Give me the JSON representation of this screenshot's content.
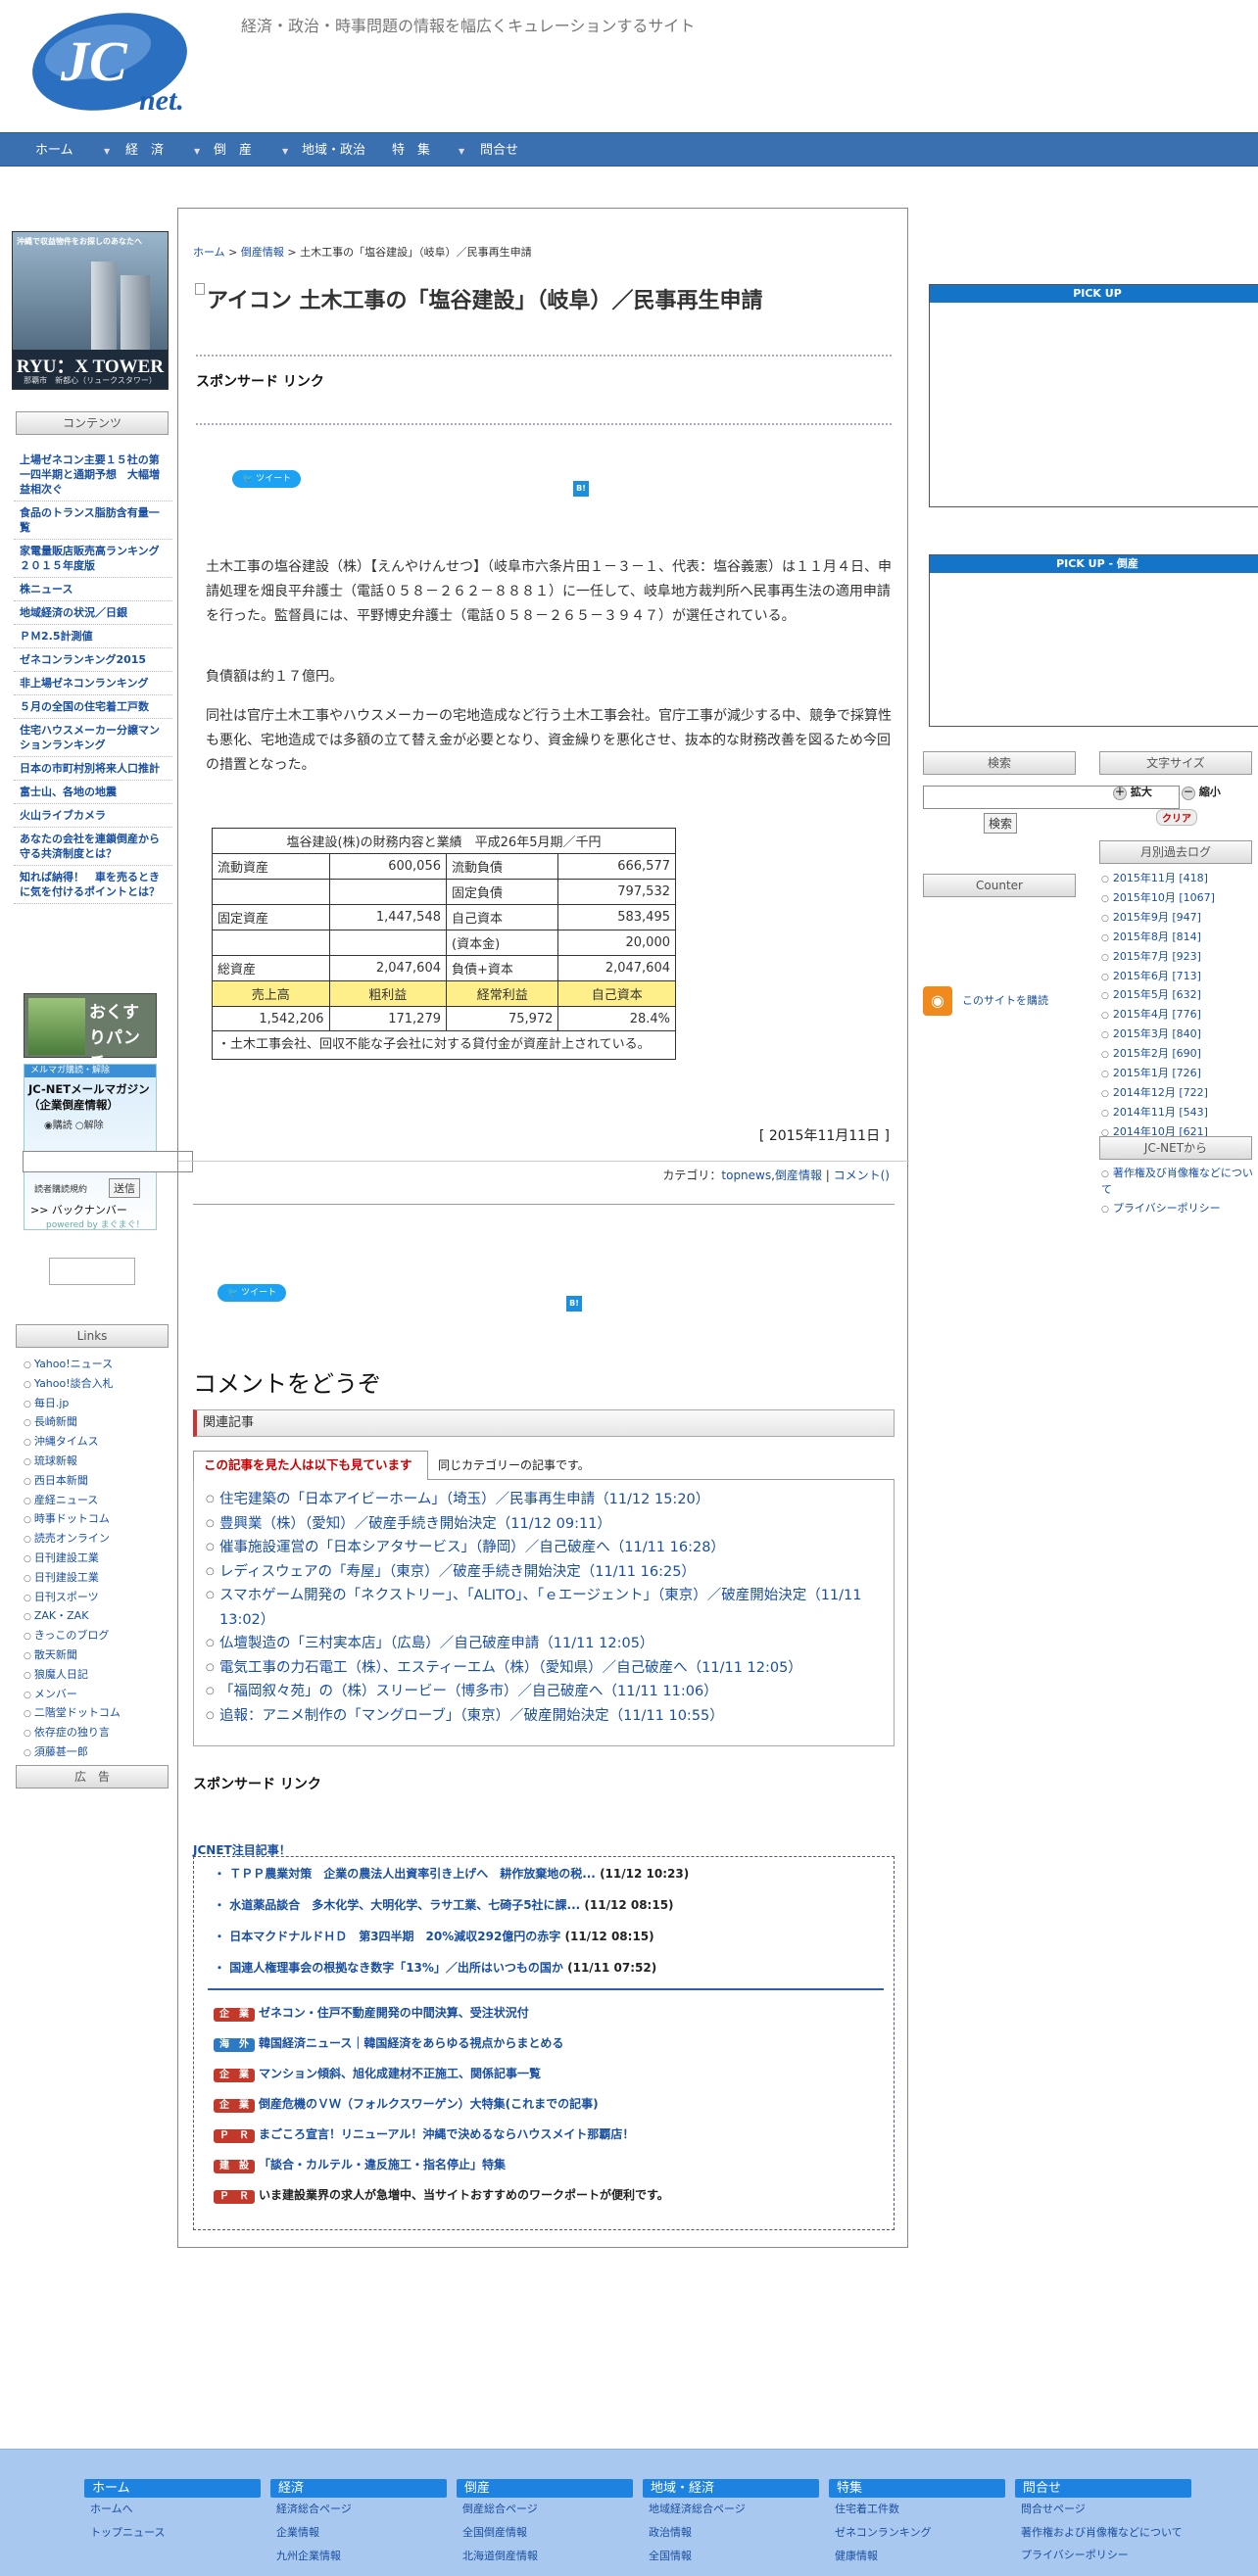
{
  "header": {
    "logo_text": "JC net.",
    "tagline": "経済・政治・時事問題の情報を幅広くキュレーションするサイト"
  },
  "nav": {
    "items": [
      "ホーム",
      "経　済",
      "倒　産",
      "地域・政治",
      "特　集",
      "問合せ"
    ]
  },
  "left": {
    "banner_top": "沖縄で収益物件をお探しのあなたへ",
    "banner_name": "RYU：X TOWER",
    "banner_sub": "那覇市　新都心（リュークスタワー）",
    "contents_title": "コンテンツ",
    "links": [
      "上場ゼネコン主要１５社の第一四半期と通期予想　大幅増益相次ぐ",
      "食品のトランス脂肪含有量一覧",
      "家電量販店販売高ランキング　２０１５年度版",
      "株ニュース",
      "地域経済の状況／日銀",
      "ＰＭ2.5計測値",
      "ゼネコンランキング2015",
      "非上場ゼネコンランキング",
      "５月の全国の住宅着工戸数",
      "住宅ハウスメーカー分譲マンションランキング",
      "日本の市町村別将来人口推計",
      "富士山、各地の地震",
      "火山ライブカメラ",
      "あなたの会社を連鎖倒産から守る共済制度とは？",
      "知れば納得！　車を売るときに気を付けるポイントとは？"
    ],
    "kusuri": "おくすりパンチ",
    "mag_head": "メルマガ購読・解除",
    "mag_title": "JC-NETメールマガジン（企業倒産情報）",
    "radio_subscribe": "購読",
    "radio_unsubscribe": "解除",
    "terms": "読者購読規約",
    "submit": "送信",
    "backnumber": ">> バックナンバー",
    "powered": "powered by まぐまぐ！",
    "links_title": "Links",
    "external_links": [
      "Yahoo!ニュース",
      "Yahoo!談合入札",
      "毎日.jp",
      "長崎新聞",
      "沖縄タイムス",
      "琉球新報",
      "西日本新聞",
      "産経ニュース",
      "時事ドットコム",
      "読売オンライン",
      "日刊建設工業",
      "日刊建設工業",
      "日刊スポーツ",
      "ZAK・ZAK",
      "きっこのブログ",
      "散天新聞",
      "狼魔人日記",
      "メンバー",
      "二階堂ドットコム",
      "依存症の独り言",
      "須藤甚一郎"
    ],
    "ad_title": "広　告"
  },
  "main": {
    "breadcrumb": [
      "ホーム",
      "倒産情報",
      "土木工事の「塩谷建設」（岐阜）／民事再生申請"
    ],
    "title": "アイコン 土木工事の「塩谷建設」（岐阜）／民事再生申請",
    "sponsored": "スポンサード リンク",
    "tweet": "ツイート",
    "hatena": "B!",
    "para1": "土木工事の塩谷建設（株）【えんやけんせつ】（岐阜市六条片田１－３－１、代表：塩谷義憲）は１１月４日、申請処理を畑良平弁護士（電話０５８－２６２－８８８１）に一任して、岐阜地方裁判所へ民事再生法の適用申請を行った。監督員には、平野博史弁護士（電話０５８－２６５－３９４７）が選任されている。",
    "para2": "負債額は約１７億円。",
    "para3": "同社は官庁土木工事やハウスメーカーの宅地造成など行う土木工事会社。官庁工事が減少する中、競争で採算性も悪化、宅地造成では多額の立て替え金が必要となり、資金繰りを悪化させ、抜本的な財務改善を図るため今回の措置となった。",
    "table": {
      "caption": "塩谷建設(株)の財務内容と業績　平成26年5月期／千円",
      "rows": [
        [
          "流動資産",
          "600,056",
          "流動負債",
          "666,577"
        ],
        [
          "",
          "",
          "固定負債",
          "797,532"
        ],
        [
          "固定資産",
          "1,447,548",
          "自己資本",
          "583,495"
        ],
        [
          "",
          "",
          "(資本金)",
          "20,000"
        ],
        [
          "総資産",
          "2,047,604",
          "負債+資本",
          "2,047,604"
        ]
      ],
      "head2": [
        "売上高",
        "粗利益",
        "経常利益",
        "自己資本"
      ],
      "vals2": [
        "1,542,206",
        "171,279",
        "75,972",
        "28.4%"
      ],
      "note": "・土木工事会社、回収不能な子会社に対する貸付金が資産計上されている。"
    },
    "date": "[ 2015年11月11日 ]",
    "category_label": "カテゴリ：",
    "categories": [
      "topnews",
      "倒産情報",
      "コメント()"
    ],
    "comment_head": "コメントをどうぞ",
    "related_title": "関連記事",
    "tab1": "この記事を見た人は以下も見ています",
    "tab2": "同じカテゴリーの記事です。",
    "related": [
      "住宅建築の「日本アイビーホーム」（埼玉）／民事再生申請（11/12 15:20）",
      "豊興業（株）（愛知）／破産手続き開始決定（11/12 09:11）",
      "催事施設運営の「日本シアタサービス」（静岡）／自己破産へ（11/11 16:28）",
      "レディスウェアの「寿屋」（東京）／破産手続き開始決定（11/11 16:25）",
      "スマホゲーム開発の「ネクストリー」、「ALITO」、「ｅエージェント」（東京）／破産開始決定（11/11 13:02）",
      "仏壇製造の「三村実本店」（広島）／自己破産申請（11/11 12:05）",
      "電気工事の力石電工（株）、エスティーエム（株）（愛知県）／自己破産へ（11/11 12:05）",
      "「福岡叙々苑」の（株）スリービー（博多市）／自己破産へ（11/11 11:06）",
      "追報：アニメ制作の「マングローブ」（東京）／破産開始決定（11/11 10:55）"
    ],
    "sponsored2": "スポンサード リンク",
    "jcnet_head": "JCNET注目記事！",
    "news": [
      {
        "t": "ＴＰＰ農業対策　企業の農法人出資率引き上げへ　耕作放棄地の税...",
        "d": "(11/12 10:23)"
      },
      {
        "t": "水道薬品談合　多木化学、大明化学、ラサ工業、七碕子5社に課...",
        "d": "(11/12 08:15)"
      },
      {
        "t": "日本マクドナルドＨＤ　第3四半期　20%減収292億円の赤字",
        "d": "(11/12 08:15)"
      },
      {
        "t": "国連人権理事会の根拠なき数字「13%」／出所はいつもの国か",
        "d": "(11/11 07:52)"
      }
    ],
    "features": [
      {
        "b": "企　業",
        "t": "ゼネコン・住戸不動産開発の中間決算、受注状況付"
      },
      {
        "b": "海　外",
        "t": "韓国経済ニュース｜韓国経済をあらゆる視点からまとめる"
      },
      {
        "b": "企　業",
        "t": "マンション傾斜、旭化成建材不正施工、関係記事一覧"
      },
      {
        "b": "企　業",
        "t": "倒産危機のＶＷ（フォルクスワーゲン）大特集(これまでの記事)"
      },
      {
        "b": "Ｐ　Ｒ",
        "t": "まごころ宣言！リニューアル！沖縄で決めるならハウスメイト那覇店！"
      },
      {
        "b": "建　設",
        "t": "「談合・カルテル・違反施工・指名停止」特集"
      },
      {
        "b": "Ｐ　Ｒ",
        "t": "いま建設業界の求人が急増中、当サイトおすすめのワークポートが便利です。"
      }
    ]
  },
  "right": {
    "pickup": "PICK UP",
    "pickup2": "PICK UP - 倒産",
    "search_label": "検索",
    "font_label": "文字サイズ",
    "enlarge": "拡大",
    "shrink": "縮小",
    "clear": "クリア",
    "search_btn": "検索",
    "counter": "Counter",
    "rss": "このサイトを購読",
    "archive_title": "月別過去ログ",
    "archive": [
      "2015年11月 [418]",
      "2015年10月 [1067]",
      "2015年9月 [947]",
      "2015年8月 [814]",
      "2015年7月 [923]",
      "2015年6月 [713]",
      "2015年5月 [632]",
      "2015年4月 [776]",
      "2015年3月 [840]",
      "2015年2月 [690]",
      "2015年1月 [726]",
      "2014年12月 [722]",
      "2014年11月 [543]",
      "2014年10月 [621]"
    ],
    "from_title": "JC-NETから",
    "from": [
      "著作権及び肖像権などについて",
      "プライバシーポリシー"
    ]
  },
  "footer": {
    "cols": [
      {
        "head": "ホーム",
        "items": [
          "ホームへ",
          "トップニュース"
        ]
      },
      {
        "head": "経済",
        "items": [
          "経済総合ページ",
          "企業情報",
          "九州企業情報"
        ]
      },
      {
        "head": "倒産",
        "items": [
          "倒産総合ページ",
          "全国倒産情報",
          "北海道倒産情報"
        ]
      },
      {
        "head": "地域・経済",
        "items": [
          "地域経済総合ページ",
          "政治情報",
          "全国情報"
        ]
      },
      {
        "head": "特集",
        "items": [
          "住宅着工件数",
          "ゼネコンランキング",
          "健康情報"
        ]
      },
      {
        "head": "問合せ",
        "items": [
          "問合せページ",
          "著作権および肖像権などについて",
          "プライバシーポリシー"
        ]
      }
    ]
  }
}
